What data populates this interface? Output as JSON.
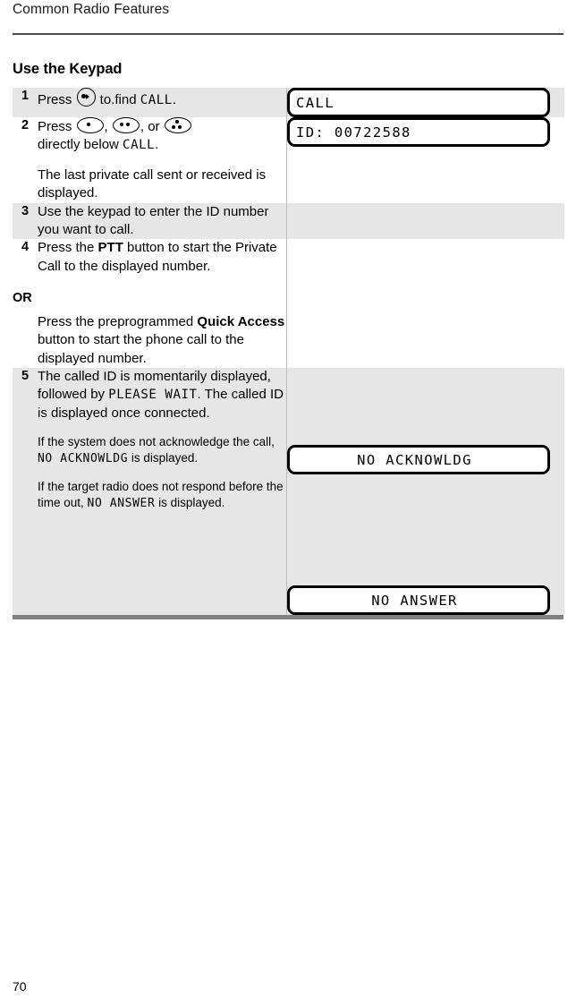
{
  "header": {
    "running_head": "Common Radio Features"
  },
  "section": {
    "title": "Use the Keypad"
  },
  "procedure": {
    "steps": [
      {
        "number": "1",
        "text_before_icon": "Press ",
        "icon": "round-select-button-icon",
        "text_after_icon": " to.find ",
        "lcd_inline": "CALL",
        "text_end": ".",
        "shaded": true,
        "lcd_label": "CALL",
        "lcd_align": "left"
      },
      {
        "number": "2",
        "lead": "Press ",
        "icon_1": "oval-one-dot-button-icon",
        "sep_1": ", ",
        "icon_2": "oval-two-dot-button-icon",
        "sep_2": ", or ",
        "icon_3": "oval-three-dot-button-icon",
        "line2_before": "directly below ",
        "line2_lcd": "CALL",
        "line2_after": ".",
        "paragraph_2": "The last private call sent or received is displayed.",
        "shaded": false,
        "lcd_label": "ID: 00722588",
        "lcd_align": "left"
      },
      {
        "number": "3",
        "paragraph_1": "Use the keypad to enter the ID number you want to call.",
        "shaded": true,
        "lcd_label": "",
        "lcd_align": "left"
      },
      {
        "number": "4",
        "p1_a": "Press the ",
        "p1_bold": "PTT",
        "p1_b": " button to start the Private Call to the displayed number.",
        "or_label": "OR",
        "p2_a": " Press the preprogrammed ",
        "p2_bold": "Quick Access",
        "p2_b": " button to start the phone call to the displayed number.",
        "shaded": false,
        "lcd_label": "",
        "lcd_align": "left"
      },
      {
        "number": "5",
        "p1_a": "The called ID is momentarily displayed, followed by ",
        "p1_lcd": "PLEASE WAIT",
        "p1_b": ". The called ID is displayed once connected.",
        "p2_a": "If the system does not acknowledge the call, ",
        "p2_lcd": "NO ACKNOWLDG",
        "p2_b": " is displayed.",
        "p3_a": "If the target radio does not respond before the time out, ",
        "p3_lcd": "NO ANSWER",
        "p3_b": " is displayed.",
        "shaded": true,
        "lcd_label_1": "NO ACKNOWLDG",
        "lcd_label_2": "NO ANSWER",
        "lcd_align": "center"
      }
    ]
  },
  "footer": {
    "page_number": "70"
  },
  "colors": {
    "shaded_row": "#e6e6e6",
    "rule": "#4a4a4a",
    "bottom_bar": "#808080",
    "text": "#000000"
  }
}
